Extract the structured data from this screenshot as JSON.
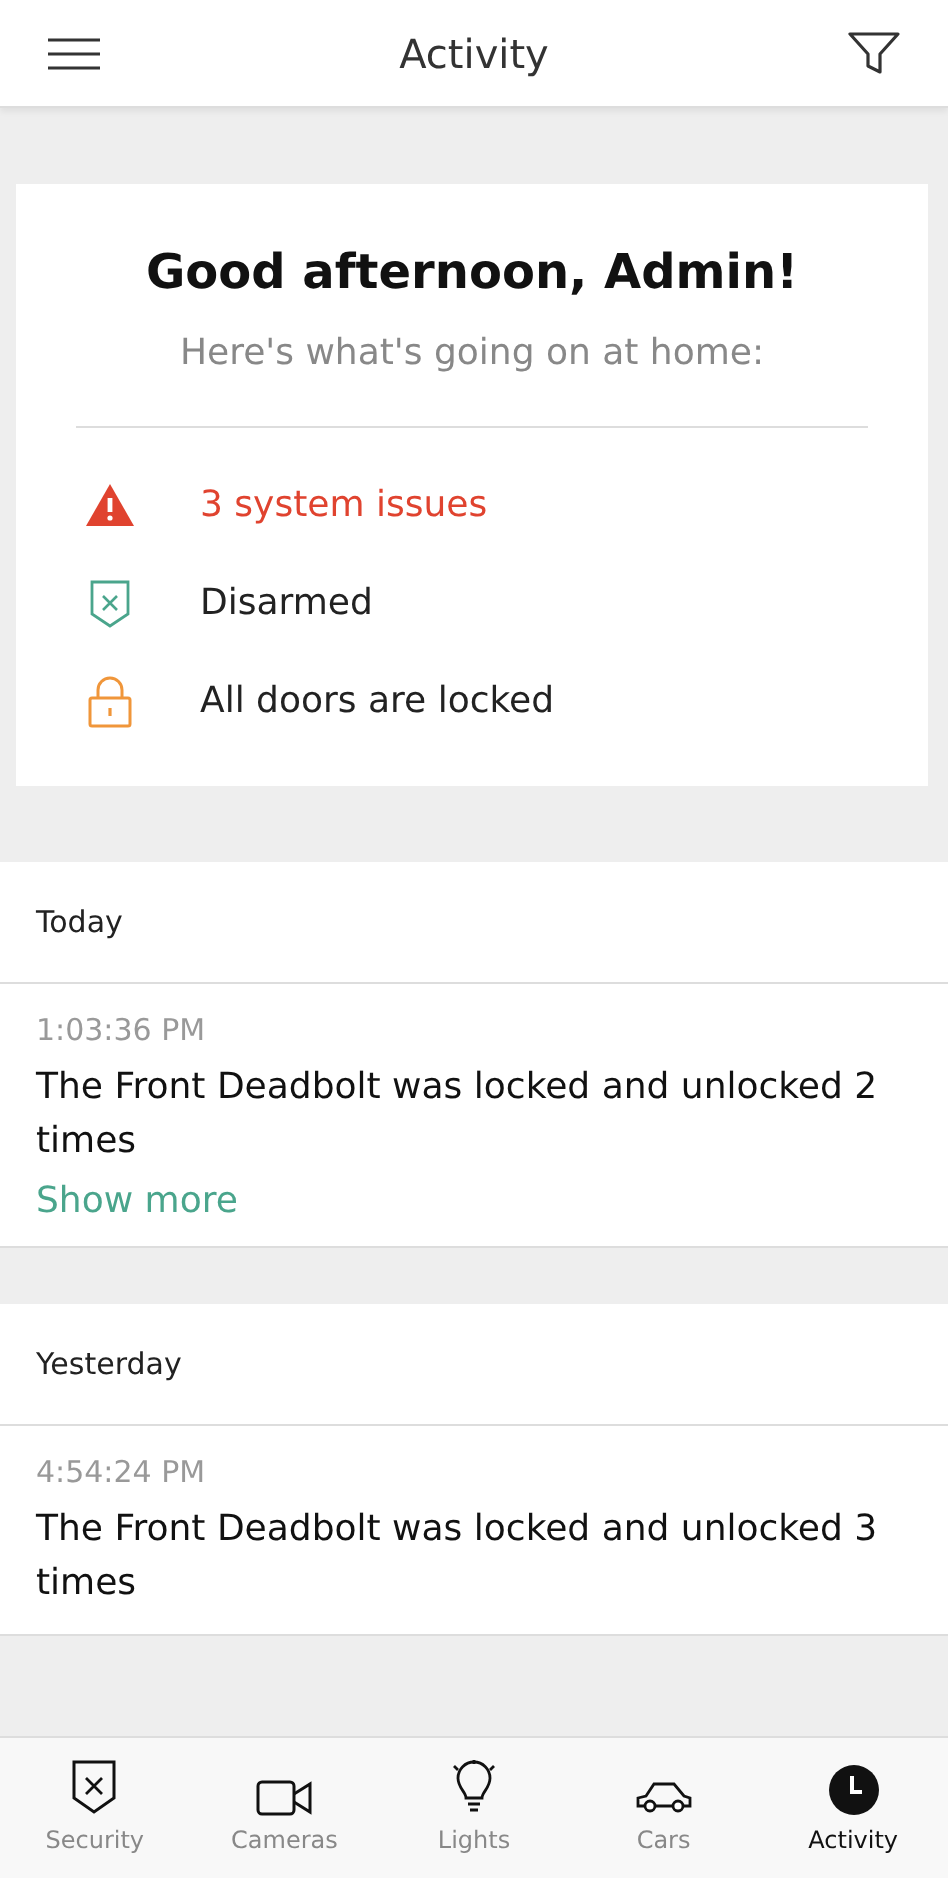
{
  "header": {
    "title": "Activity"
  },
  "summary": {
    "greeting": "Good afternoon, Admin!",
    "subtitle": "Here's what's going on at home:",
    "items": [
      {
        "kind": "alert",
        "text": "3 system issues"
      },
      {
        "kind": "disarmed",
        "text": "Disarmed"
      },
      {
        "kind": "locked",
        "text": "All doors are locked"
      }
    ]
  },
  "groups": [
    {
      "label": "Today",
      "entries": [
        {
          "time": "1:03:36 PM",
          "text": "The Front Deadbolt was locked and unlocked 2 times",
          "link": "Show more"
        }
      ]
    },
    {
      "label": "Yesterday",
      "entries": [
        {
          "time": "4:54:24 PM",
          "text": "The Front Deadbolt was locked and unlocked 3 times"
        }
      ]
    }
  ],
  "tabs": [
    {
      "kind": "security",
      "label": "Security",
      "selected": false
    },
    {
      "kind": "cameras",
      "label": "Cameras",
      "selected": false
    },
    {
      "kind": "lights",
      "label": "Lights",
      "selected": false
    },
    {
      "kind": "cars",
      "label": "Cars",
      "selected": false
    },
    {
      "kind": "activity",
      "label": "Activity",
      "selected": true
    }
  ]
}
